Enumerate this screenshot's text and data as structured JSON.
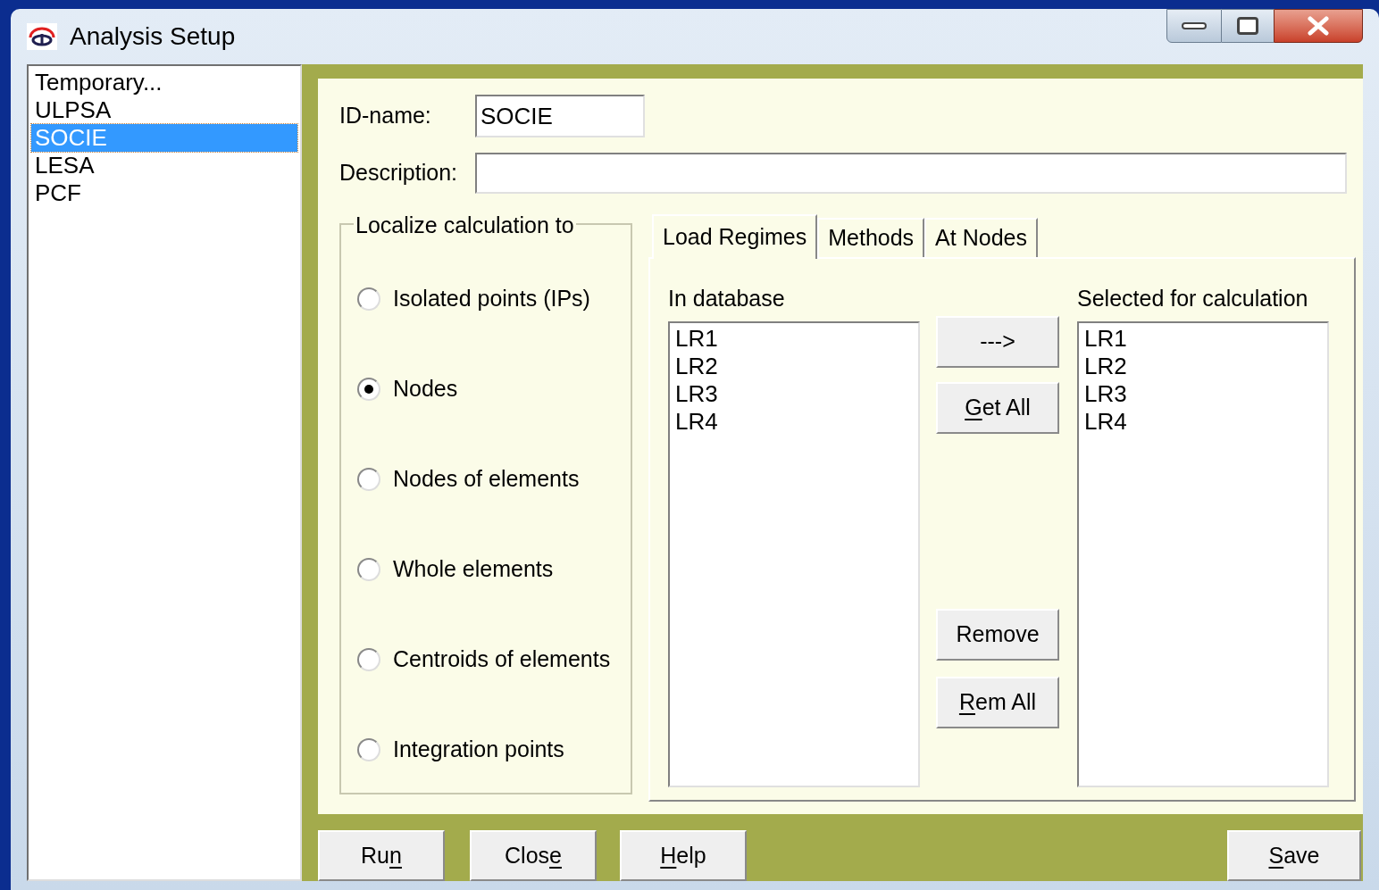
{
  "window": {
    "title": "Analysis Setup"
  },
  "setups": [
    {
      "label": "Temporary...",
      "selected": false
    },
    {
      "label": "ULPSA",
      "selected": false
    },
    {
      "label": "SOCIE",
      "selected": true
    },
    {
      "label": "LESA",
      "selected": false
    },
    {
      "label": "PCF",
      "selected": false
    }
  ],
  "id_name": {
    "label": "ID-name:",
    "value": "SOCIE"
  },
  "description": {
    "label": "Description:"
  },
  "localize": {
    "title": "Localize calculation to",
    "options": [
      {
        "label": "Isolated points (IPs)",
        "selected": false
      },
      {
        "label": "Nodes",
        "selected": true
      },
      {
        "label": "Nodes of elements",
        "selected": false
      },
      {
        "label": "Whole elements",
        "selected": false
      },
      {
        "label": "Centroids of elements",
        "selected": false
      },
      {
        "label": "Integration points",
        "selected": false
      }
    ]
  },
  "tabs": [
    {
      "label": "Load Regimes",
      "selected": true
    },
    {
      "label": "Methods",
      "selected": false
    },
    {
      "label": "At Nodes",
      "selected": false
    }
  ],
  "in_database": {
    "title": "In database",
    "items": [
      "LR1",
      "LR2",
      "LR3",
      "LR4"
    ]
  },
  "transfer_buttons": [
    {
      "parts": [
        {
          "text": "--->",
          "underlined": false
        }
      ]
    },
    {
      "parts": [
        {
          "text": "G",
          "underlined": true
        },
        {
          "text": "et All",
          "underlined": false
        }
      ]
    },
    {
      "parts": [
        {
          "text": "Remove",
          "underlined": false
        }
      ]
    },
    {
      "parts": [
        {
          "text": "R",
          "underlined": true
        },
        {
          "text": "em All",
          "underlined": false
        }
      ]
    }
  ],
  "selected_for_calculation": {
    "title": "Selected for calculation",
    "items": [
      "LR1",
      "LR2",
      "LR3",
      "LR4"
    ]
  },
  "footer_buttons": [
    {
      "parts": [
        {
          "text": "Ru",
          "underlined": false
        },
        {
          "text": "n",
          "underlined": true
        }
      ]
    },
    {
      "parts": [
        {
          "text": "Clos",
          "underlined": false
        },
        {
          "text": "e",
          "underlined": true
        }
      ]
    },
    {
      "parts": [
        {
          "text": "H",
          "underlined": true
        },
        {
          "text": "elp",
          "underlined": false
        }
      ]
    },
    {
      "parts": [
        {
          "text": "S",
          "underlined": true
        },
        {
          "text": "ave",
          "underlined": false
        }
      ]
    }
  ]
}
